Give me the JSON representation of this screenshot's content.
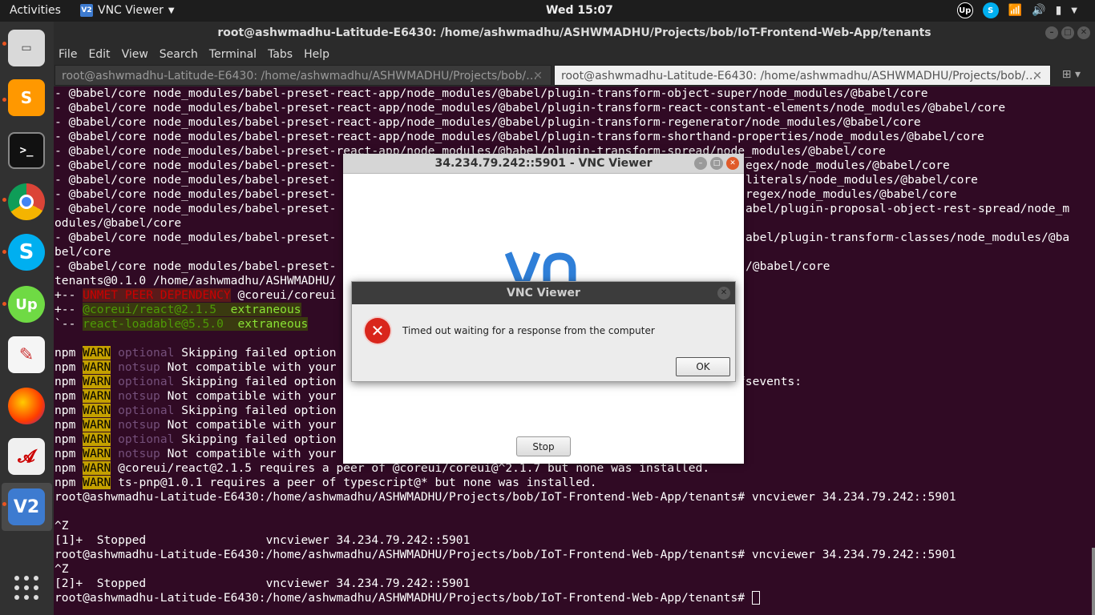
{
  "topbar": {
    "activities": "Activities",
    "app_name": "VNC Viewer",
    "clock": "Wed 15:07"
  },
  "terminal": {
    "title": "root@ashwmadhu-Latitude-E6430: /home/ashwmadhu/ASHWMADHU/Projects/bob/IoT-Frontend-Web-App/tenants",
    "menu": [
      "File",
      "Edit",
      "View",
      "Search",
      "Terminal",
      "Tabs",
      "Help"
    ],
    "tabs": [
      {
        "label": "root@ashwmadhu-Latitude-E6430: /home/ashwmadhu/ASHWMADHU/Projects/bob/…"
      },
      {
        "label": "root@ashwmadhu-Latitude-E6430: /home/ashwmadhu/ASHWMADHU/Projects/bob/…"
      }
    ],
    "lines": {
      "l0": "- @babel/core node_modules/babel-preset-react-app/node_modules/@babel/plugin-transform-object-super/node_modules/@babel/core",
      "l1": "- @babel/core node_modules/babel-preset-react-app/node_modules/@babel/plugin-transform-react-constant-elements/node_modules/@babel/core",
      "l2": "- @babel/core node_modules/babel-preset-react-app/node_modules/@babel/plugin-transform-regenerator/node_modules/@babel/core",
      "l3": "- @babel/core node_modules/babel-preset-react-app/node_modules/@babel/plugin-transform-shorthand-properties/node_modules/@babel/core",
      "l4": "- @babel/core node_modules/babel-preset-react-app/node_modules/@babel/plugin-transform-spread/node_modules/@babel/core",
      "l5a": "- @babel/core node_modules/babel-preset-",
      "l5b": "egex/node_modules/@babel/core",
      "l6a": "- @babel/core node_modules/babel-preset-",
      "l6b": "literals/node_modules/@babel/core",
      "l7a": "- @babel/core node_modules/babel-preset-",
      "l7b": "regex/node_modules/@babel/core",
      "l8a": "- @babel/core node_modules/babel-preset-",
      "l8b": "abel/plugin-proposal-object-rest-spread/node_m",
      "l9": "odules/@babel/core",
      "l10a": "- @babel/core node_modules/babel-preset-",
      "l10b": "abel/plugin-transform-classes/node_modules/@ba",
      "l11": "bel/core",
      "l12a": "- @babel/core node_modules/babel-preset-",
      "l12b": "/@babel/core",
      "l13": "tenants@0.1.0 /home/ashwmadhu/ASHWMADHU/",
      "l14_prefix": "+-- ",
      "l14_red": "UNMET PEER DEPENDENCY",
      "l14_rest": " @coreui/coreui",
      "l15_prefix": "+-- ",
      "l15_green": "@coreui/react@2.1.5",
      "l15_extra": "extraneous",
      "l16_prefix": "`-- ",
      "l16_green": "react-loadable@5.5.0",
      "l16_extra": "extraneous",
      "npm": "npm",
      "warn": "WARN",
      "optional": "optional",
      "notsup": "notsup",
      "skipping": " Skipping failed option",
      "notcompat": " Not compatible with your",
      "fsevents": "fsevents:",
      "peer1": " @coreui/react@2.1.5 requires a peer of @coreui/coreui@^2.1.7 but none was installed.",
      "peer2": " ts-pnp@1.0.1 requires a peer of typescript@* but none was installed.",
      "cmd1": "root@ashwmadhu-Latitude-E6430:/home/ashwmadhu/ASHWMADHU/Projects/bob/IoT-Frontend-Web-App/tenants# vncviewer 34.234.79.242::5901",
      "ctrlz": "^Z",
      "stopped1": "[1]+  Stopped                 vncviewer 34.234.79.242::5901",
      "cmd2": "root@ashwmadhu-Latitude-E6430:/home/ashwmadhu/ASHWMADHU/Projects/bob/IoT-Frontend-Web-App/tenants# vncviewer 34.234.79.242::5901",
      "stopped2": "[2]+  Stopped                 vncviewer 34.234.79.242::5901",
      "prompt": "root@ashwmadhu-Latitude-E6430:/home/ashwmadhu/ASHWMADHU/Projects/bob/IoT-Frontend-Web-App/tenants# "
    }
  },
  "vnc_window": {
    "title": "34.234.79.242::5901 - VNC Viewer",
    "stop_label": "Stop"
  },
  "dialog": {
    "title": "VNC Viewer",
    "message": "Timed out waiting for a response from the computer",
    "ok_label": "OK"
  },
  "colors": {
    "terminal_bg": "#300a24",
    "warn_bg": "#c4a000",
    "error_red": "#d9261c",
    "accent": "#e95420"
  }
}
